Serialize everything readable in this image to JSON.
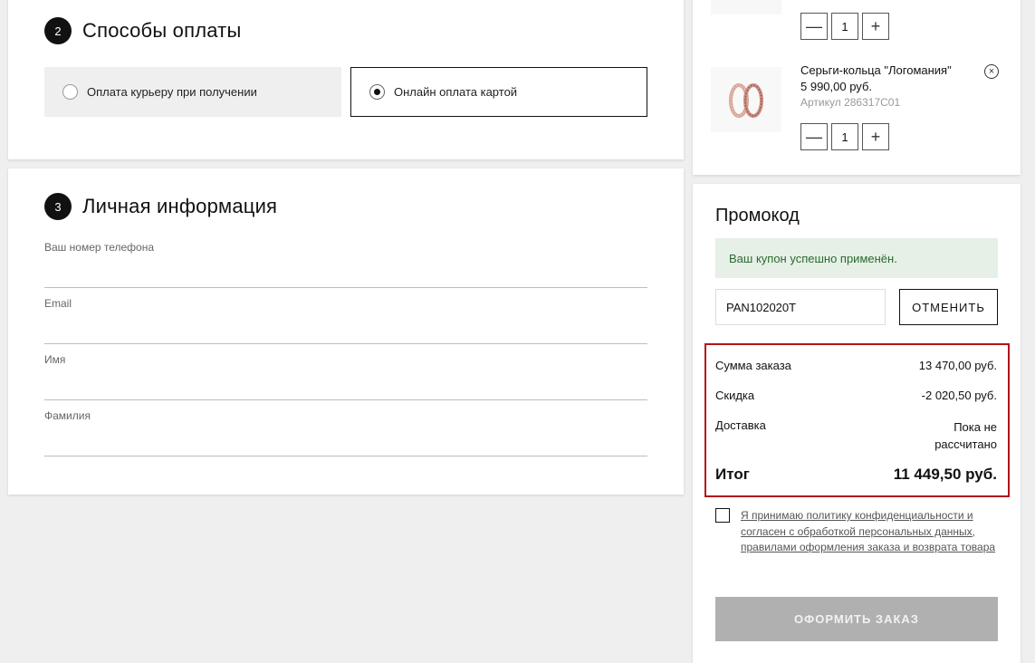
{
  "payment": {
    "step_number": "2",
    "title": "Способы оплаты",
    "options": [
      {
        "label": "Оплата курьеру при получении",
        "selected": false
      },
      {
        "label": "Онлайн оплата картой",
        "selected": true
      }
    ]
  },
  "personal": {
    "step_number": "3",
    "title": "Личная информация",
    "fields": [
      {
        "label": "Ваш номер телефона",
        "value": ""
      },
      {
        "label": "Email",
        "value": ""
      },
      {
        "label": "Имя",
        "value": ""
      },
      {
        "label": "Фамилия",
        "value": ""
      }
    ]
  },
  "cart": {
    "items": [
      {
        "quantity": "1"
      },
      {
        "name": "Серьги-кольца \"Логомания\"",
        "price": "5 990,00 руб.",
        "sku": "Артикул 286317C01",
        "quantity": "1"
      }
    ],
    "minus_symbol": "—",
    "plus_symbol": "+",
    "remove_symbol": "×"
  },
  "promo": {
    "title": "Промокод",
    "success_message": "Ваш купон успешно применён.",
    "code_value": "PAN102020T",
    "cancel_label": "ОТМЕНИТЬ"
  },
  "summary": {
    "subtotal_label": "Сумма заказа",
    "subtotal_value": "13 470,00 руб.",
    "discount_label": "Скидка",
    "discount_value": "-2 020,50 руб.",
    "delivery_label": "Доставка",
    "delivery_value_line1": "Пока не",
    "delivery_value_line2": "рассчитано",
    "total_label": "Итог",
    "total_value": "11 449,50 руб."
  },
  "agreement": {
    "text": "Я принимаю политику конфиденциальности и согласен с обработкой персональных данных, правилами оформления заказа и возврата товара",
    "checked": false
  },
  "submit_label": "ОФОРМИТЬ ЗАКАЗ",
  "colors": {
    "highlight_border": "#b3141a",
    "success_bg": "#e6f0e7",
    "success_text": "#2a6a2c",
    "disabled_button": "#b0b0b0"
  }
}
